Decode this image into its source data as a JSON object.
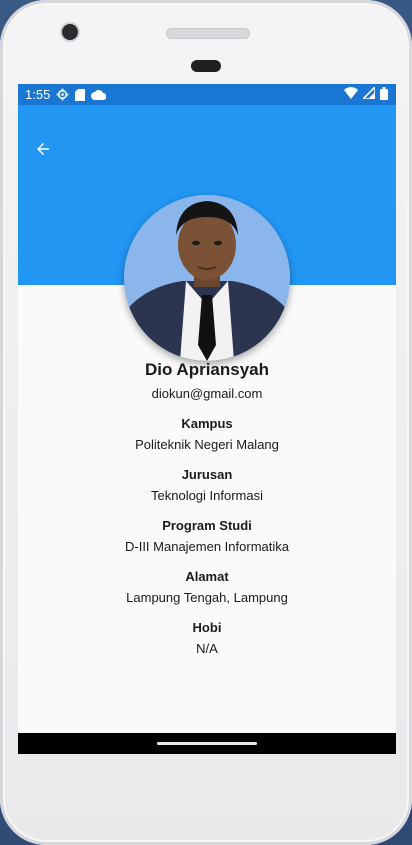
{
  "status_bar": {
    "time": "1:55",
    "left_icons": [
      "settings-icon",
      "sd-card-icon",
      "cloud-icon"
    ],
    "right_icons": [
      "wifi-icon",
      "signal-icon",
      "battery-icon"
    ]
  },
  "header": {
    "color": "#2196f3",
    "back_icon": "arrow-left-icon"
  },
  "profile": {
    "name": "Dio Apriansyah",
    "email": "diokun@gmail.com",
    "fields": [
      {
        "label": "Kampus",
        "value": "Politeknik Negeri Malang"
      },
      {
        "label": "Jurusan",
        "value": "Teknologi Informasi"
      },
      {
        "label": "Program Studi",
        "value": "D-III Manajemen Informatika"
      },
      {
        "label": "Alamat",
        "value": "Lampung Tengah, Lampung"
      },
      {
        "label": "Hobi",
        "value": "N/A"
      }
    ]
  },
  "colors": {
    "status_bar": "#1976d2",
    "accent": "#2196f3",
    "background": "#fafafa"
  }
}
